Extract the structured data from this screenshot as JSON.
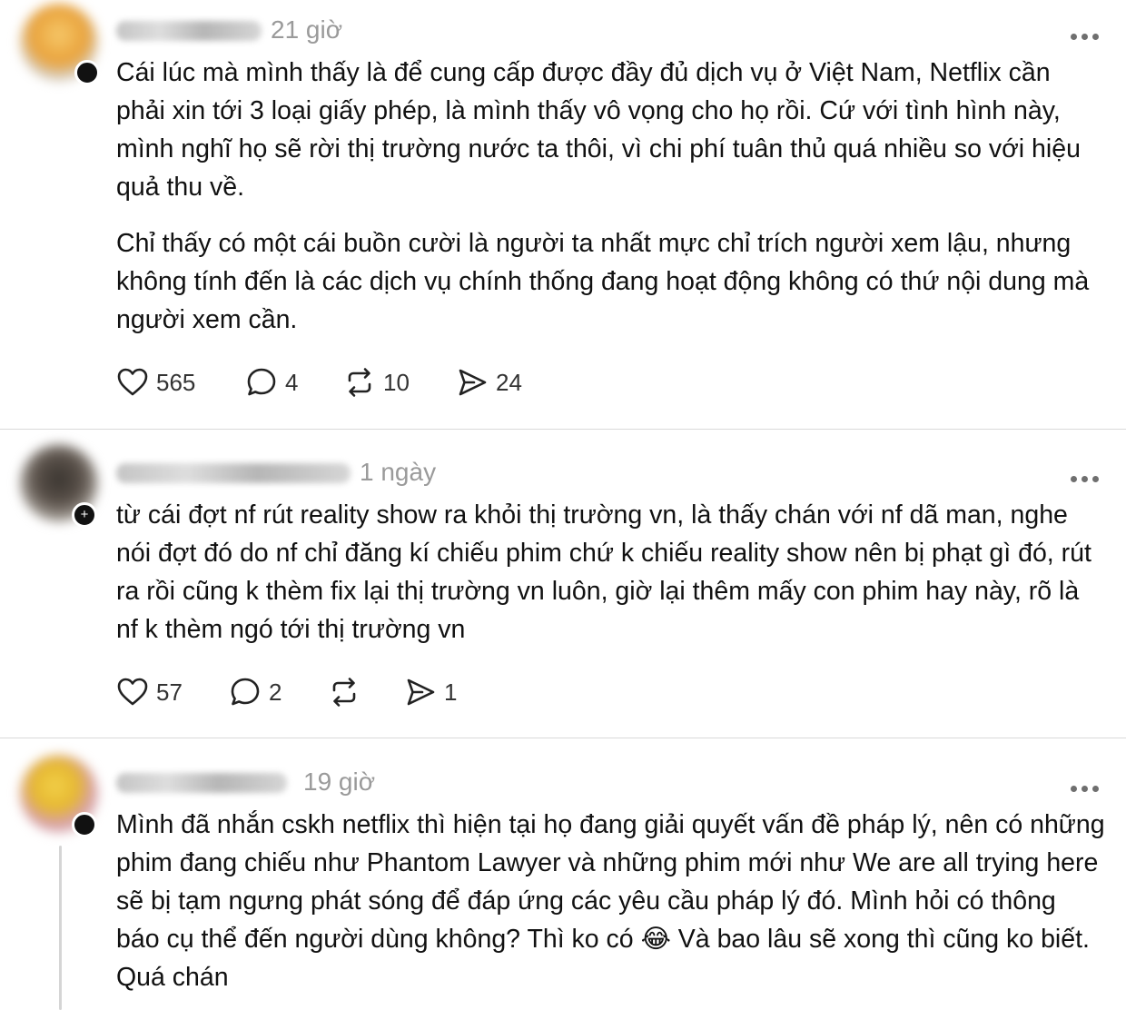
{
  "posts": [
    {
      "time": "21 giờ",
      "paragraphs": [
        "Cái lúc mà mình thấy là để cung cấp được đầy đủ dịch vụ ở Việt Nam, Netflix cần phải xin tới 3 loại giấy phép, là mình thấy vô vọng cho họ rồi. Cứ với tình hình này, mình nghĩ họ sẽ rời thị trường nước ta thôi, vì chi phí tuân thủ quá nhiều so với hiệu quả thu về.",
        "Chỉ thấy có một cái buồn cười là người ta nhất mực chỉ trích người xem lậu, nhưng không tính đến là các dịch vụ chính thống đang hoạt động không có thứ nội dung mà người xem cần."
      ],
      "likes": "565",
      "replies": "4",
      "reposts": "10",
      "shares": "24"
    },
    {
      "time": "1 ngày",
      "paragraphs": [
        "từ cái đợt nf rút reality show ra khỏi thị trường vn, là thấy chán với nf dã man, nghe nói đợt đó do nf chỉ đăng kí chiếu phim chứ k chiếu reality show nên bị phạt gì đó, rút ra rồi cũng k thèm fix lại thị trường vn luôn, giờ lại thêm mấy con phim hay này, rõ là nf k thèm ngó tới thị trường vn"
      ],
      "likes": "57",
      "replies": "2",
      "reposts": "",
      "shares": "1"
    },
    {
      "time": "19 giờ",
      "paragraphs": [
        "Mình đã nhắn cskh netflix thì hiện tại họ đang giải quyết vấn đề pháp lý, nên có những phim đang chiếu như Phantom Lawyer và những phim mới như We are all trying here sẽ bị tạm ngưng phát sóng để đáp ứng các yêu cầu pháp lý đó. Mình hỏi có thông báo cụ thể đến người dùng không? Thì ko có 😂 Và bao lâu sẽ xong thì cũng ko biết. Quá chán"
      ]
    }
  ],
  "icons": [
    "heart-icon",
    "comment-icon",
    "repost-icon",
    "share-icon",
    "more-icon",
    "follow-plus-icon"
  ]
}
